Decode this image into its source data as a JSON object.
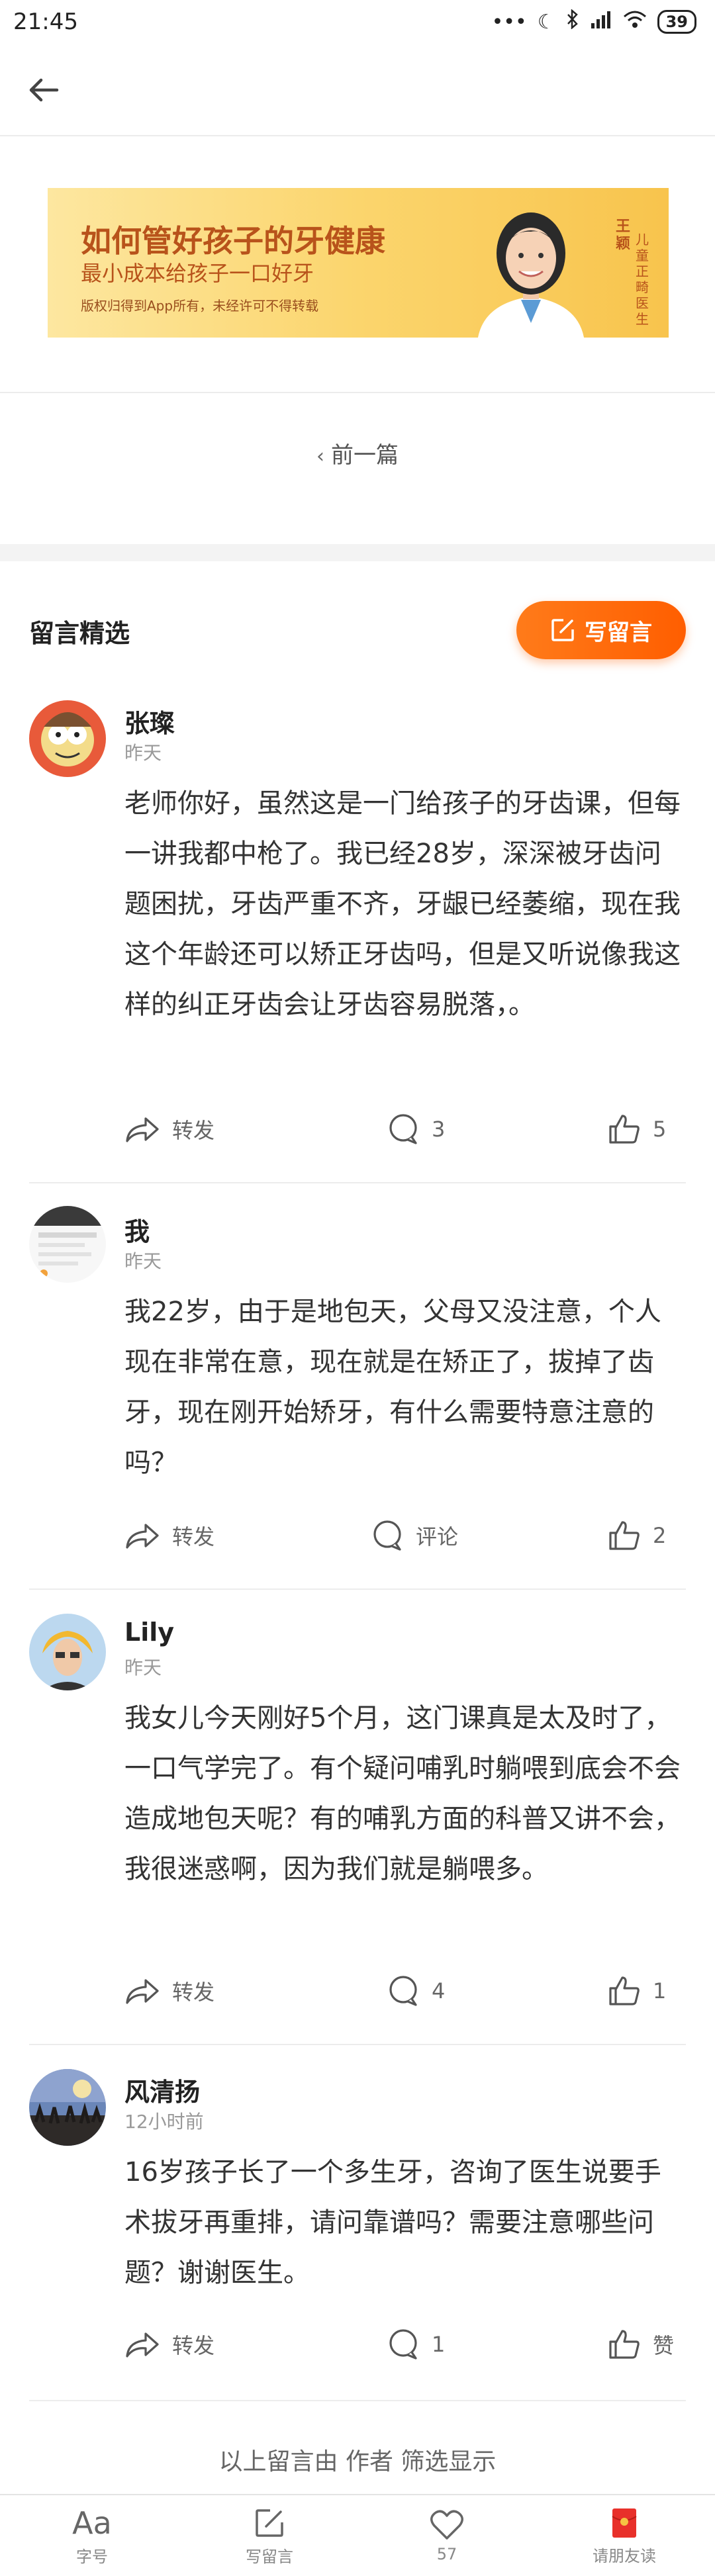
{
  "status_bar": {
    "time": "21:45",
    "dots": "•••",
    "battery": "39"
  },
  "banner": {
    "title": "如何管好孩子的牙健康",
    "subtitle": "最小成本给孩子一口好牙",
    "note": "版权归得到App所有，未经许可不得转载",
    "author": "王颖",
    "role": "儿童正畸医生"
  },
  "prev": {
    "label": "前一篇"
  },
  "comments_section": {
    "title": "留言精选",
    "write_label": "写留言",
    "items": [
      {
        "name": "张璨",
        "time": "昨天",
        "text": "老师你好，虽然这是一门给孩子的牙齿课，但每一讲我都中枪了。我已经28岁，深深被牙齿问题困扰，牙齿严重不齐，牙龈已经萎缩，现在我这个年龄还可以矫正牙齿吗，但是又听说像我这样的纠正牙齿会让牙齿容易脱落，。",
        "share": "转发",
        "comments": "3",
        "likes": "5"
      },
      {
        "name": "我",
        "time": "昨天",
        "text": "我22岁，由于是地包天，父母又没注意，个人现在非常在意，现在就是在矫正了，拔掉了齿牙，现在刚开始矫牙，有什么需要特意注意的吗？",
        "share": "转发",
        "comments": "评论",
        "likes": "2"
      },
      {
        "name": "Lily",
        "time": "昨天",
        "text": "我女儿今天刚好5个月，这门课真是太及时了，一口气学完了。有个疑问哺乳时躺喂到底会不会造成地包天呢？有的哺乳方面的科普又讲不会，我很迷惑啊，因为我们就是躺喂多。",
        "share": "转发",
        "comments": "4",
        "likes": "1"
      },
      {
        "name": "风清扬",
        "time": "12小时前",
        "text": "16岁孩子长了一个多生牙，咨询了医生说要手术拔牙再重排，请问靠谱吗？需要注意哪些问题？谢谢医生。",
        "share": "转发",
        "comments": "1",
        "likes": "赞"
      }
    ],
    "footer": "以上留言由 作者 筛选显示"
  },
  "bottom_bar": {
    "tabs": [
      {
        "icon": "Aa",
        "label": "字号"
      },
      {
        "label": "写留言"
      },
      {
        "label": "57"
      },
      {
        "label": "请朋友读"
      }
    ]
  },
  "colors": {
    "accent": "#ff6a0d",
    "banner_text": "#b8531b"
  }
}
